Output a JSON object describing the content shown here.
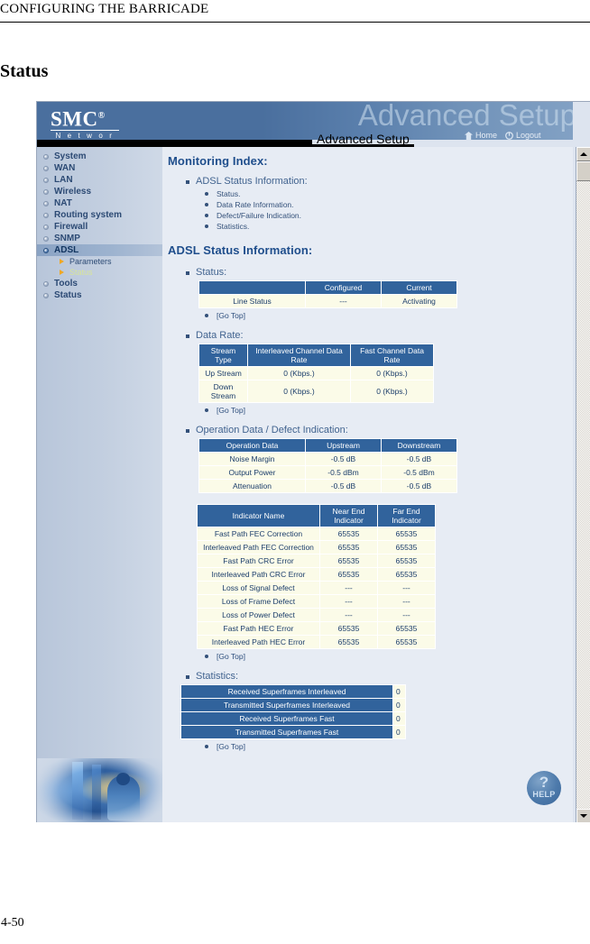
{
  "manual": {
    "running_head": "CONFIGURING THE BARRICADE",
    "section_title": "Status",
    "page_number": "4-50"
  },
  "banner": {
    "logo_primary": "SMC",
    "logo_registered": "®",
    "logo_secondary": "N e t w o r k s",
    "ghost_text": "Advanced Setup",
    "tab_label": "Advanced Setup",
    "home_label": "Home",
    "logout_label": "Logout",
    "home_icon": "home-icon",
    "logout_icon": "logout-icon"
  },
  "sidebar": {
    "items": [
      {
        "label": "System",
        "active": false
      },
      {
        "label": "WAN",
        "active": false
      },
      {
        "label": "LAN",
        "active": false
      },
      {
        "label": "Wireless",
        "active": false
      },
      {
        "label": "NAT",
        "active": false
      },
      {
        "label": "Routing system",
        "active": false
      },
      {
        "label": "Firewall",
        "active": false
      },
      {
        "label": "SNMP",
        "active": false
      },
      {
        "label": "ADSL",
        "active": true
      },
      {
        "label": "Tools",
        "active": false
      },
      {
        "label": "Status",
        "active": false
      }
    ],
    "subitems": [
      {
        "label": "Parameters",
        "selected": false
      },
      {
        "label": "Status",
        "selected": true
      }
    ],
    "photo_alt": "technician-at-server-rack-photo"
  },
  "content": {
    "monitoring_index_title": "Monitoring Index:",
    "index_top": "ADSL Status Information:",
    "index_children": [
      "Status.",
      "Data Rate Information.",
      "Defect/Failure Indication.",
      "Statistics."
    ],
    "adsl_status_title": "ADSL Status Information:",
    "go_top_label": "[Go Top]",
    "status_block": {
      "heading": "Status:",
      "columns": [
        "",
        "Configured",
        "Current"
      ],
      "rows": [
        [
          "Line Status",
          "---",
          "Activating"
        ]
      ]
    },
    "data_rate_block": {
      "heading": "Data Rate:",
      "columns": [
        "Stream Type",
        "Interleaved Channel Data Rate",
        "Fast Channel Data Rate"
      ],
      "rows": [
        [
          "Up Stream",
          "0 (Kbps.)",
          "0 (Kbps.)"
        ],
        [
          "Down Stream",
          "0 (Kbps.)",
          "0 (Kbps.)"
        ]
      ]
    },
    "operation_block": {
      "heading": "Operation Data / Defect Indication:",
      "columns": [
        "Operation Data",
        "Upstream",
        "Downstream"
      ],
      "rows": [
        [
          "Noise Margin",
          "-0.5 dB",
          "-0.5 dB"
        ],
        [
          "Output Power",
          "-0.5 dBm",
          "-0.5 dBm"
        ],
        [
          "Attenuation",
          "-0.5 dB",
          "-0.5 dB"
        ]
      ]
    },
    "indicator_block": {
      "columns": [
        "Indicator Name",
        "Near End Indicator",
        "Far End Indicator"
      ],
      "rows": [
        [
          "Fast Path FEC Correction",
          "65535",
          "65535"
        ],
        [
          "Interleaved Path FEC Correction",
          "65535",
          "65535"
        ],
        [
          "Fast Path CRC Error",
          "65535",
          "65535"
        ],
        [
          "Interleaved Path CRC Error",
          "65535",
          "65535"
        ],
        [
          "Loss of Signal Defect",
          "---",
          "---"
        ],
        [
          "Loss of Frame Defect",
          "---",
          "---"
        ],
        [
          "Loss of Power Defect",
          "---",
          "---"
        ],
        [
          "Fast Path HEC Error",
          "65535",
          "65535"
        ],
        [
          "Interleaved Path HEC Error",
          "65535",
          "65535"
        ]
      ]
    },
    "statistics_block": {
      "heading": "Statistics:",
      "rows": [
        [
          "Received Superframes Interleaved",
          "0"
        ],
        [
          "Transmitted Superframes Interleaved",
          "0"
        ],
        [
          "Received Superframes Fast",
          "0"
        ],
        [
          "Transmitted Superframes Fast",
          "0"
        ]
      ]
    },
    "help_button": {
      "symbol": "?",
      "label": "HELP"
    }
  },
  "colors": {
    "banner_blue": "#4a6f9e",
    "table_header_blue": "#31639c",
    "table_cell_cream": "#fbfbe8",
    "sidebar_blue": "#b8c6da",
    "content_bg": "#e7ecf4",
    "heading_blue": "#1f4e8c",
    "sub_selected_yellow": "#d8e49a",
    "arrow_orange": "#f0a823"
  }
}
